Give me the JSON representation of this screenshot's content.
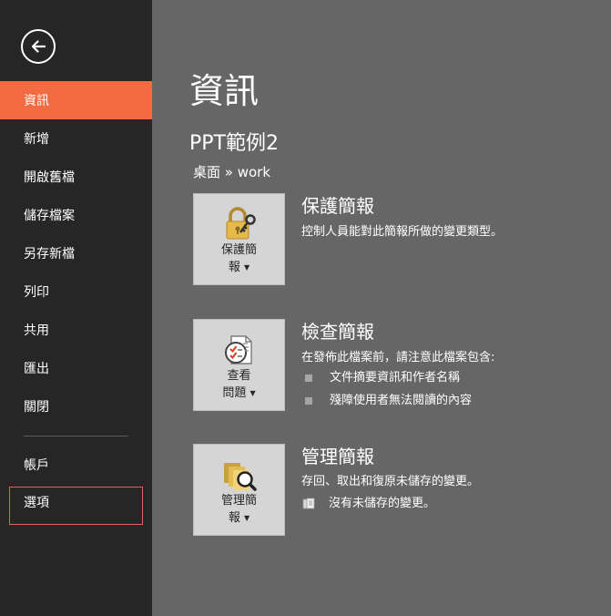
{
  "sidebar": {
    "back_icon": "arrow-left-icon",
    "items": [
      {
        "label": "資訊"
      },
      {
        "label": "新增"
      },
      {
        "label": "開啟舊檔"
      },
      {
        "label": "儲存檔案"
      },
      {
        "label": "另存新檔"
      },
      {
        "label": "列印"
      },
      {
        "label": "共用"
      },
      {
        "label": "匯出"
      },
      {
        "label": "關閉"
      },
      {
        "label": "帳戶"
      },
      {
        "label": "選項"
      }
    ]
  },
  "main": {
    "title": "資訊",
    "doc_name": "PPT範例2",
    "doc_path": "桌面 » work",
    "sections": [
      {
        "tile_label_line1": "保護簡",
        "tile_label_line2": "報",
        "icon": "lock-key-icon",
        "title": "保護簡報",
        "desc": "控制人員能對此簡報所做的變更類型。"
      },
      {
        "tile_label_line1": "查看",
        "tile_label_line2": "問題",
        "icon": "inspect-document-icon",
        "title": "檢查簡報",
        "desc": "在發佈此檔案前，請注意此檔案包含:",
        "bullets": [
          "文件摘要資訊和作者名稱",
          "殘障使用者無法閱讀的內容"
        ]
      },
      {
        "tile_label_line1": "管理簡",
        "tile_label_line2": "報",
        "icon": "manage-versions-icon",
        "title": "管理簡報",
        "desc": "存回、取出和復原未儲存的變更。",
        "note": "沒有未儲存的變更。"
      }
    ]
  },
  "colors": {
    "sidebar_bg": "#262626",
    "active_item": "#f26b43",
    "main_bg": "#666666",
    "highlight_border": "#e8605c",
    "tile_bg": "#d5d5d5"
  }
}
